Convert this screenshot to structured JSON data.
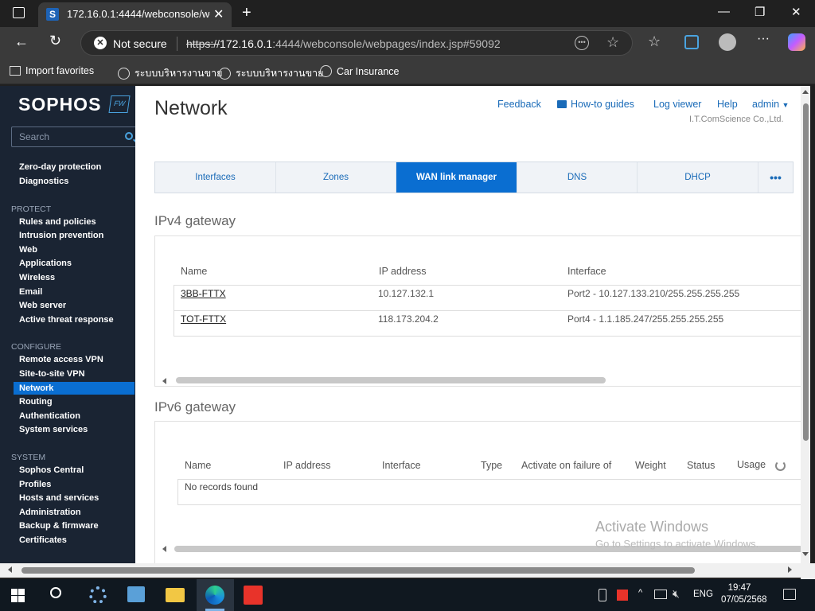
{
  "browser": {
    "tab_title": "172.16.0.1:4444/webconsole/web",
    "tab_favicon": "S",
    "security_label": "Not secure",
    "url_scheme": "https://",
    "url_host": "172.16.0.1",
    "url_rest": ":4444/webconsole/webpages/index.jsp#59092",
    "favorites": [
      "Import favorites",
      "ระบบบริหารงานขาย",
      "ระบบบริหารงานขาย",
      "Car Insurance"
    ]
  },
  "sidebar": {
    "logo": "SOPHOS",
    "badge": "FW",
    "search_placeholder": "Search",
    "monitor_items": [
      "Zero-day protection",
      "Diagnostics"
    ],
    "protect_heading": "PROTECT",
    "protect_items": [
      "Rules and policies",
      "Intrusion prevention",
      "Web",
      "Applications",
      "Wireless",
      "Email",
      "Web server",
      "Active threat response"
    ],
    "configure_heading": "CONFIGURE",
    "configure_items": [
      "Remote access VPN",
      "Site-to-site VPN",
      "Network",
      "Routing",
      "Authentication",
      "System services"
    ],
    "system_heading": "SYSTEM",
    "system_items": [
      "Sophos Central",
      "Profiles",
      "Hosts and services",
      "Administration",
      "Backup & firmware",
      "Certificates"
    ]
  },
  "header": {
    "title": "Network",
    "links": [
      "Feedback",
      "How-to guides",
      "Log viewer",
      "Help",
      "admin"
    ],
    "company": "I.T.ComScience Co.,Ltd."
  },
  "tabs": [
    "Interfaces",
    "Zones",
    "WAN link manager",
    "DNS",
    "DHCP",
    "•••"
  ],
  "active_tab": "WAN link manager",
  "ipv4": {
    "title": "IPv4 gateway",
    "columns": [
      "Name",
      "IP address",
      "Interface"
    ],
    "rows": [
      {
        "name": "3BB-FTTX",
        "ip": "10.127.132.1",
        "interface": "Port2 - 10.127.133.210/255.255.255.255"
      },
      {
        "name": "TOT-FTTX",
        "ip": "118.173.204.2",
        "interface": "Port4 - 1.1.185.247/255.255.255.255"
      }
    ]
  },
  "ipv6": {
    "title": "IPv6 gateway",
    "columns": [
      "Name",
      "IP address",
      "Interface",
      "Type",
      "Activate on failure of",
      "Weight",
      "Status",
      "Usage"
    ],
    "empty_text": "No records found"
  },
  "watermark": {
    "line1": "Activate Windows",
    "line2": "Go to Settings to activate Windows."
  },
  "taskbar": {
    "lang": "ENG",
    "time": "19:47",
    "date": "07/05/2568"
  },
  "colors": {
    "accent": "#0a6ed1",
    "sidebar_bg": "#1a2433",
    "link": "#1a6bb8"
  }
}
